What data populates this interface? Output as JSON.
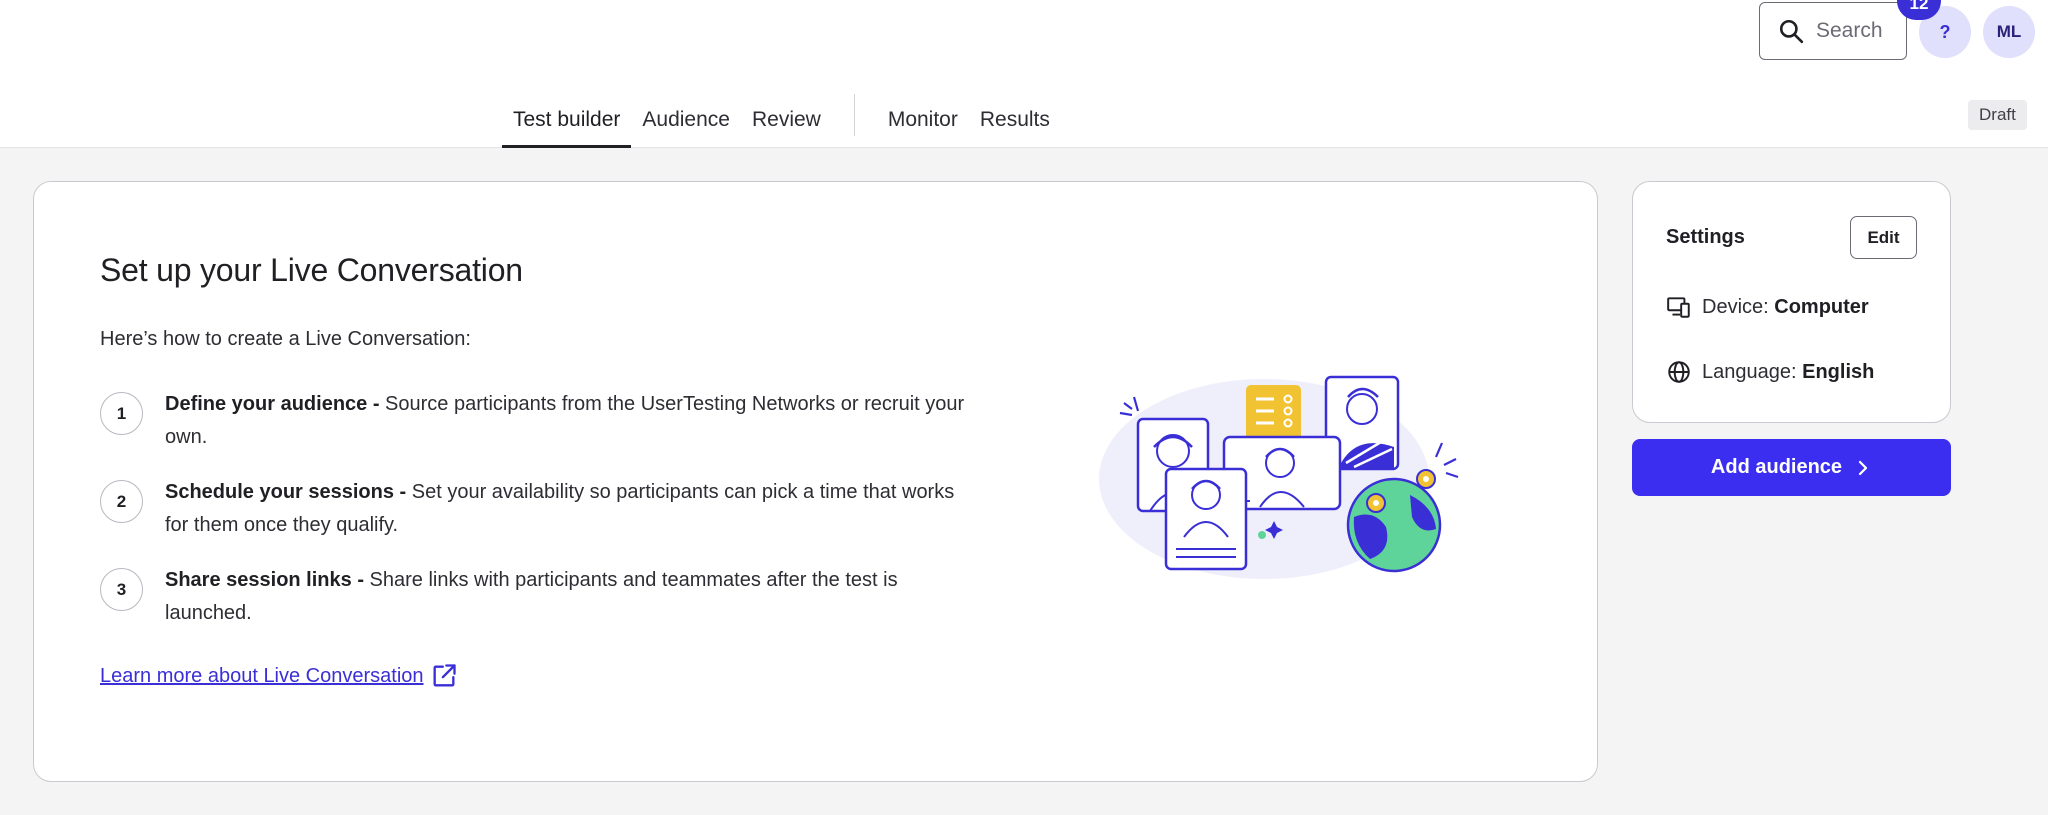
{
  "header": {
    "search_label": "Search",
    "help_label": "?",
    "notification_count": "12",
    "avatar_initials": "ML",
    "draft_label": "Draft",
    "tabs": [
      {
        "label": "Test builder",
        "active": true
      },
      {
        "label": "Audience",
        "active": false
      },
      {
        "label": "Review",
        "active": false
      },
      {
        "label": "Monitor",
        "active": false
      },
      {
        "label": "Results",
        "active": false
      }
    ]
  },
  "main": {
    "title": "Set up your Live Conversation",
    "intro": "Here’s how to create a Live Conversation:",
    "steps": [
      {
        "number": "1",
        "title": "Define your audience -",
        "body": " Source participants from the UserTesting Networks or recruit your own."
      },
      {
        "number": "2",
        "title": "Schedule your sessions -",
        "body": " Set your availability so participants can pick a time that works for them once they qualify."
      },
      {
        "number": "3",
        "title": "Share session links -",
        "body": " Share links with participants and teammates after the test is launched."
      }
    ],
    "learn_more": "Learn more about Live Conversation"
  },
  "settings": {
    "title": "Settings",
    "edit_label": "Edit",
    "device_label": "Device:",
    "device_value": "Computer",
    "language_label": "Language:",
    "language_value": "English",
    "add_audience_label": "Add audience"
  },
  "colors": {
    "accent": "#3b2ef0",
    "accent_light": "#e0dffc",
    "background": "#f4f4f5"
  }
}
